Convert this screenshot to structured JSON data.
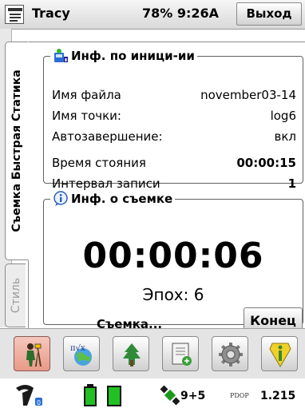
{
  "header": {
    "app_title": "Tracy",
    "status": "78% 9:26A",
    "exit_label": "Выход"
  },
  "tabs": {
    "active_label": "Съемка Быстрая Статика",
    "inactive_label": "Стиль"
  },
  "init_info": {
    "title": "Инф. по иници-ии",
    "file_name_label": "Имя файла",
    "file_name_value": "november03-14",
    "point_name_label": "Имя точки:",
    "point_name_value": "log6",
    "autofinish_label": "Автозавершение:",
    "autofinish_value": "вкл",
    "occupation_label": "Время стояния",
    "occupation_value": "00:00:15",
    "interval_label": "Интервал записи",
    "interval_value": "1"
  },
  "survey_info": {
    "title": "Инф. о съемке",
    "elapsed": "00:00:06",
    "epochs": "Эпох: 6",
    "status": "Съемка...",
    "end_label": "Конец"
  },
  "toolbar": {
    "items": [
      "surveyor-icon",
      "calculator-globe-icon",
      "tree-icon",
      "notebook-icon",
      "gear-icon",
      "info-icon"
    ]
  },
  "statusbar": {
    "satellites": "9+5",
    "pdop_label": "PDOP",
    "pdop_value": "1.215"
  },
  "colors": {
    "active_tool": "#e89a88",
    "battery": "#22c022",
    "satellite": "#1a9a1a"
  }
}
